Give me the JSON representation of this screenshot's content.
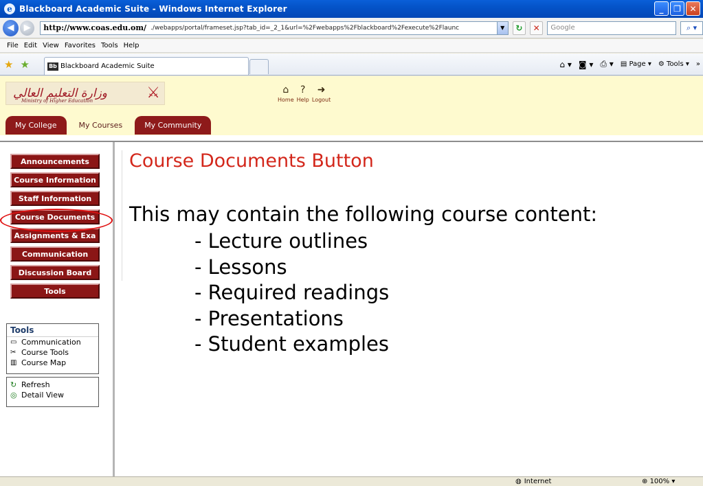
{
  "window": {
    "title": "Blackboard Academic Suite - Windows Internet Explorer",
    "minimize": "_",
    "restore": "❐",
    "close": "✕"
  },
  "address": {
    "host": "http://www.coas.edu.om/",
    "path": "./webapps/portal/frameset.jsp?tab_id=_2_1&url=%2Fwebapps%2Fblackboard%2Fexecute%2Flaunc",
    "search_placeholder": "Google"
  },
  "menu": [
    "File",
    "Edit",
    "View",
    "Favorites",
    "Tools",
    "Help"
  ],
  "browser_tab": {
    "label": "Blackboard Academic Suite",
    "icon_text": "Bb"
  },
  "commandbar": {
    "page_label": "Page",
    "tools_label": "Tools"
  },
  "header": {
    "logo_arabic": "وزارة التعليم العالي",
    "logo_sub": "Ministry of Higher Education",
    "nav": [
      "Home",
      "Help",
      "Logout"
    ],
    "tabs": [
      "My College",
      "My Courses",
      "My Community"
    ],
    "active_tab": "My Courses"
  },
  "course_menu": [
    "Announcements",
    "Course Information",
    "Staff Information",
    "Course Documents",
    "Assignments & Exa",
    "Communication",
    "Discussion Board",
    "Tools"
  ],
  "tools_panel": {
    "title": "Tools",
    "items": [
      "Communication",
      "Course Tools",
      "Course Map"
    ],
    "actions": [
      "Refresh",
      "Detail View"
    ]
  },
  "content": {
    "title": "Course Documents Button",
    "intro": "This may contain the following course content:",
    "items": [
      "- Lecture outlines",
      "- Lessons",
      "- Required readings",
      "- Presentations",
      "- Student examples"
    ]
  },
  "status": {
    "zone": "Internet",
    "zoom": "100%"
  },
  "colors": {
    "course_button": "#8b1616",
    "header_bg": "#fefacf",
    "title_red": "#d3271b"
  }
}
